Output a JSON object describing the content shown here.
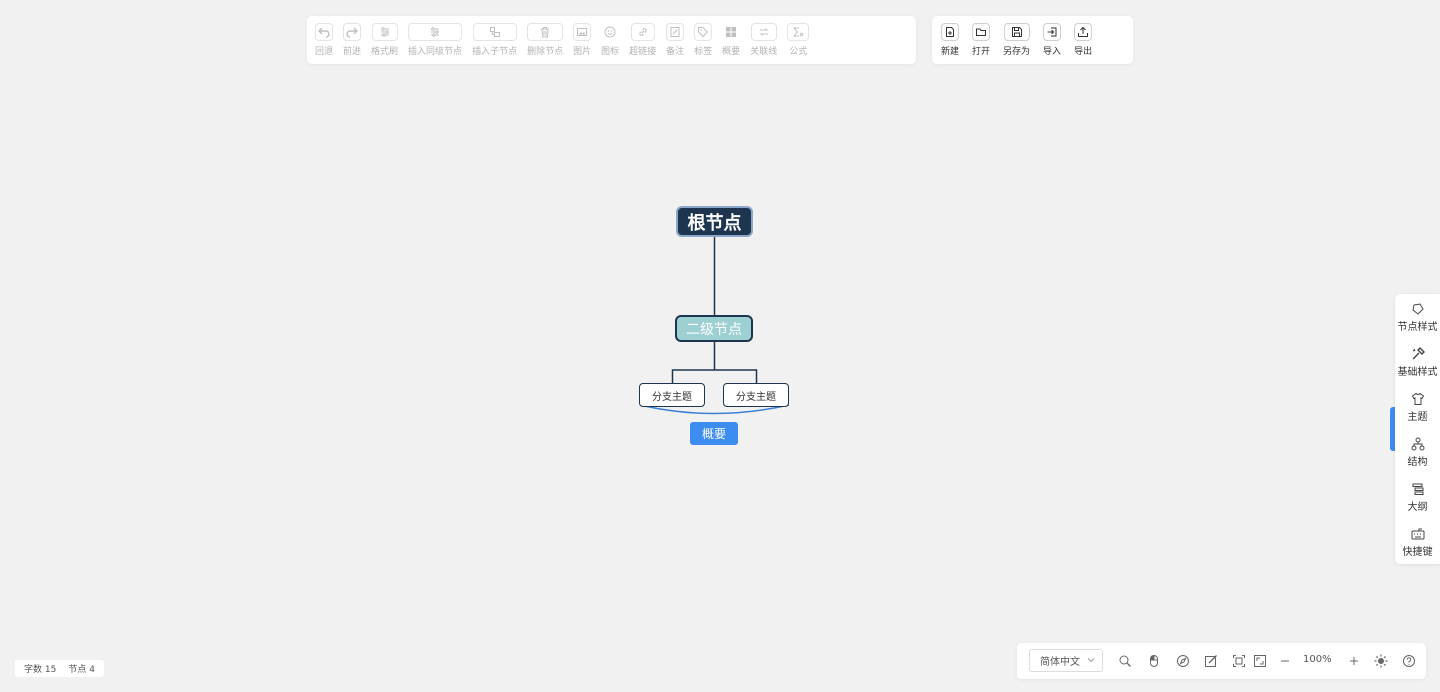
{
  "toolbar": {
    "edit_items": [
      {
        "label": "回退",
        "icon": "undo-icon"
      },
      {
        "label": "前进",
        "icon": "redo-icon"
      },
      {
        "label": "格式刷",
        "icon": "format-brush-icon"
      },
      {
        "label": "插入同级节点",
        "icon": "insert-sibling-icon"
      },
      {
        "label": "插入子节点",
        "icon": "insert-child-icon"
      },
      {
        "label": "删除节点",
        "icon": "delete-icon"
      },
      {
        "label": "图片",
        "icon": "image-icon"
      },
      {
        "label": "图标",
        "icon": "emoji-icon"
      },
      {
        "label": "超链接",
        "icon": "link-icon"
      },
      {
        "label": "备注",
        "icon": "note-icon"
      },
      {
        "label": "标签",
        "icon": "tag-icon"
      },
      {
        "label": "概要",
        "icon": "summary-icon"
      },
      {
        "label": "关联线",
        "icon": "relation-line-icon"
      },
      {
        "label": "公式",
        "icon": "formula-icon"
      }
    ],
    "file_items": [
      {
        "label": "新建",
        "icon": "new-file-icon"
      },
      {
        "label": "打开",
        "icon": "open-folder-icon"
      },
      {
        "label": "另存为",
        "icon": "save-as-icon"
      },
      {
        "label": "导入",
        "icon": "import-icon"
      },
      {
        "label": "导出",
        "icon": "export-icon"
      }
    ]
  },
  "mindmap": {
    "root": "根节点",
    "second": "二级节点",
    "branches": [
      "分支主题",
      "分支主题"
    ],
    "summary": "概要"
  },
  "side_panel": {
    "items": [
      {
        "label": "节点样式",
        "icon": "node-style-icon"
      },
      {
        "label": "基础样式",
        "icon": "base-style-icon"
      },
      {
        "label": "主题",
        "icon": "theme-shirt-icon"
      },
      {
        "label": "结构",
        "icon": "structure-icon"
      },
      {
        "label": "大纲",
        "icon": "outline-icon"
      },
      {
        "label": "快捷键",
        "icon": "keyboard-icon"
      }
    ]
  },
  "stats": {
    "word_label": "字数",
    "word_count": "15",
    "node_label": "节点",
    "node_count": "4"
  },
  "bottom_bar": {
    "language": "简体中文",
    "zoom": "100%",
    "icons": [
      "search-icon",
      "mouse-icon",
      "compass-icon",
      "edit-icon",
      "fit-screen-icon",
      "fullscreen-icon",
      "zoom-out-icon",
      "zoom-in-icon",
      "theme-sun-icon",
      "help-icon"
    ]
  },
  "colors": {
    "root_fill": "#1e3550",
    "second_fill": "#9dd0d2",
    "summary_fill": "#3d8cf0",
    "line": "#1e3550",
    "summary_brace": "#3d7fd6"
  }
}
